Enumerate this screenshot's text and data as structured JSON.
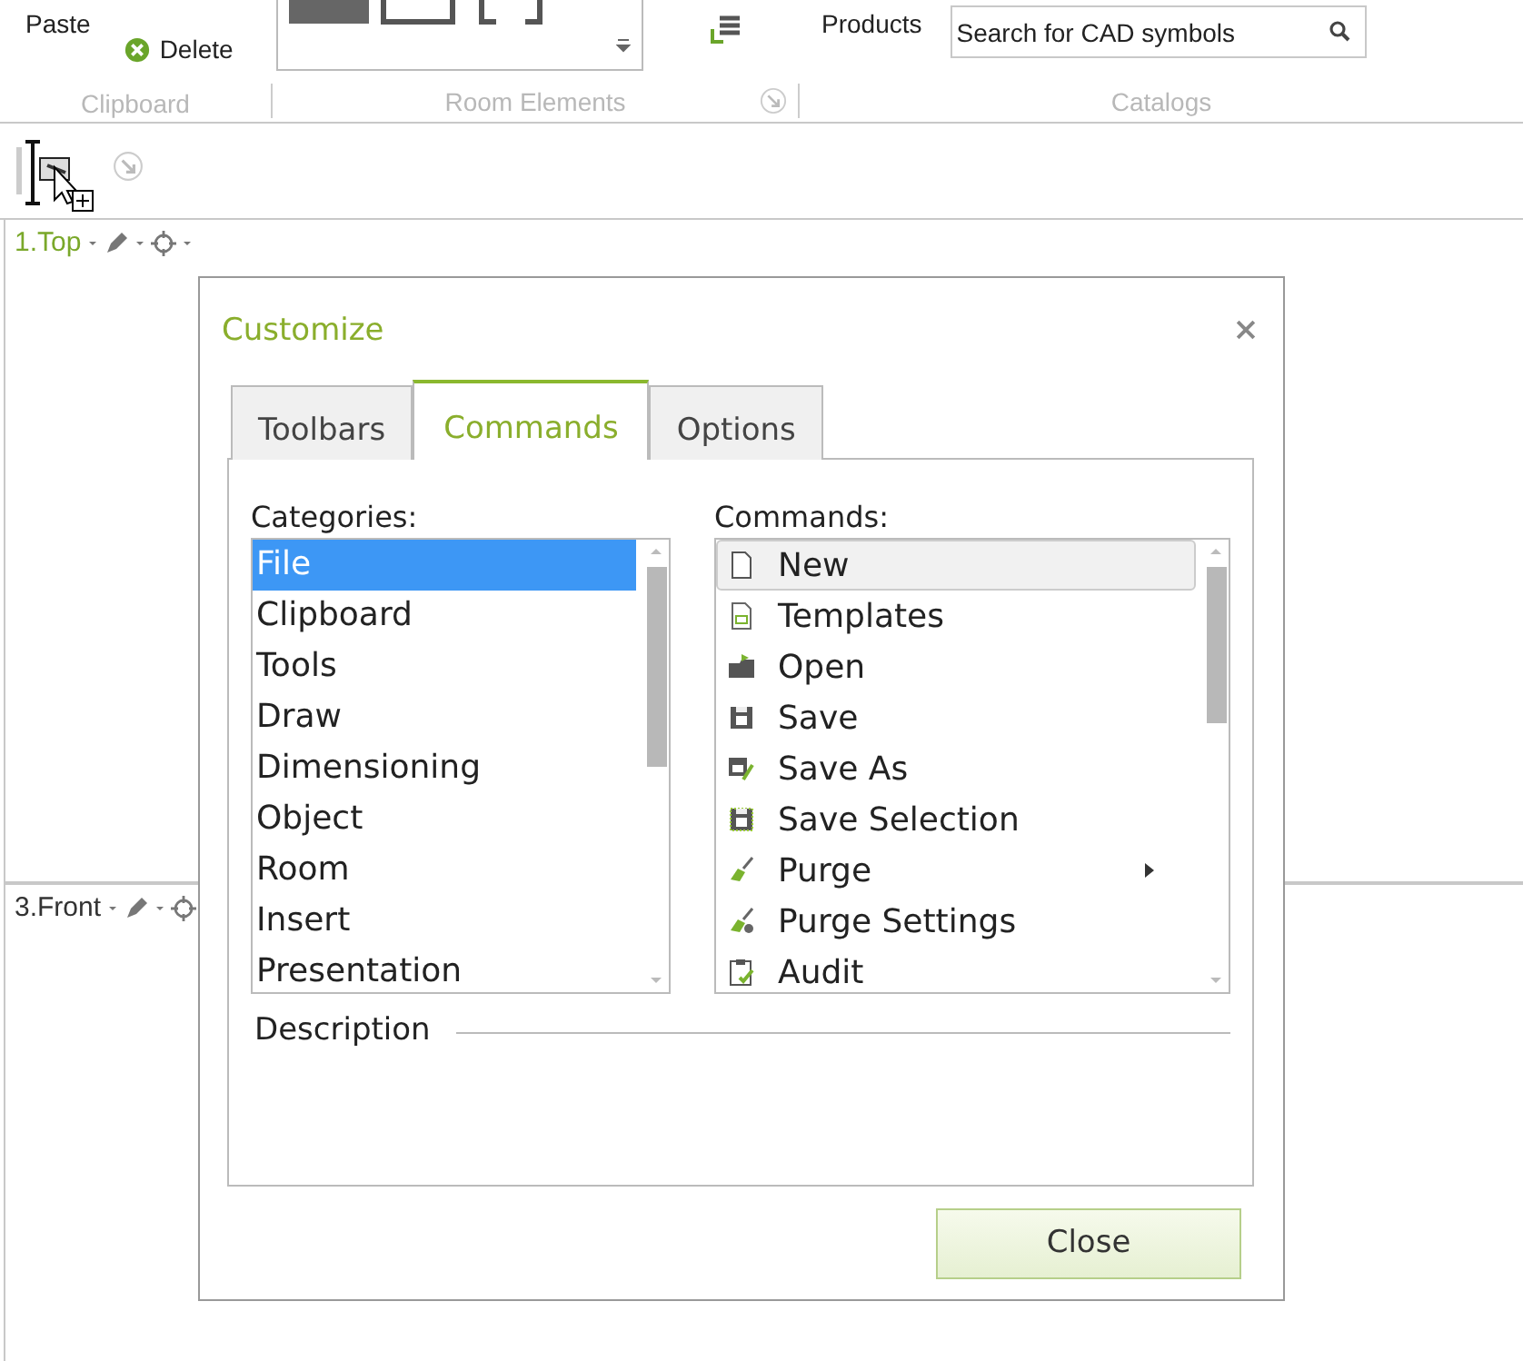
{
  "ribbon": {
    "clipboard": {
      "paste": "Paste",
      "delete": "Delete",
      "label": "Clipboard"
    },
    "room_elements": {
      "label": "Room Elements"
    },
    "catalogs": {
      "products": "Products",
      "search": {
        "placeholder": "Search for CAD symbols"
      },
      "label": "Catalogs"
    }
  },
  "viewports": [
    {
      "name": "1.Top",
      "active": true
    },
    {
      "name": "3.Front",
      "active": false
    }
  ],
  "dialog": {
    "title": "Customize",
    "tabs": [
      {
        "label": "Toolbars",
        "selected": false
      },
      {
        "label": "Commands",
        "selected": true
      },
      {
        "label": "Options",
        "selected": false
      }
    ],
    "categories": {
      "label": "Categories:",
      "items": [
        {
          "name": "File",
          "selected": true
        },
        {
          "name": "Clipboard",
          "selected": false
        },
        {
          "name": "Tools",
          "selected": false
        },
        {
          "name": "Draw",
          "selected": false
        },
        {
          "name": "Dimensioning",
          "selected": false
        },
        {
          "name": "Object",
          "selected": false
        },
        {
          "name": "Room",
          "selected": false
        },
        {
          "name": "Insert",
          "selected": false
        },
        {
          "name": "Presentation",
          "selected": false
        }
      ]
    },
    "commands": {
      "label": "Commands:",
      "items": [
        {
          "name": "New",
          "selected": true,
          "submenu": false
        },
        {
          "name": "Templates",
          "selected": false,
          "submenu": false
        },
        {
          "name": "Open",
          "selected": false,
          "submenu": false
        },
        {
          "name": "Save",
          "selected": false,
          "submenu": false
        },
        {
          "name": "Save As",
          "selected": false,
          "submenu": false
        },
        {
          "name": "Save Selection",
          "selected": false,
          "submenu": false
        },
        {
          "name": "Purge",
          "selected": false,
          "submenu": true
        },
        {
          "name": "Purge Settings",
          "selected": false,
          "submenu": false
        },
        {
          "name": "Audit",
          "selected": false,
          "submenu": false
        }
      ]
    },
    "description": {
      "label": "Description"
    },
    "close_button": "Close"
  }
}
